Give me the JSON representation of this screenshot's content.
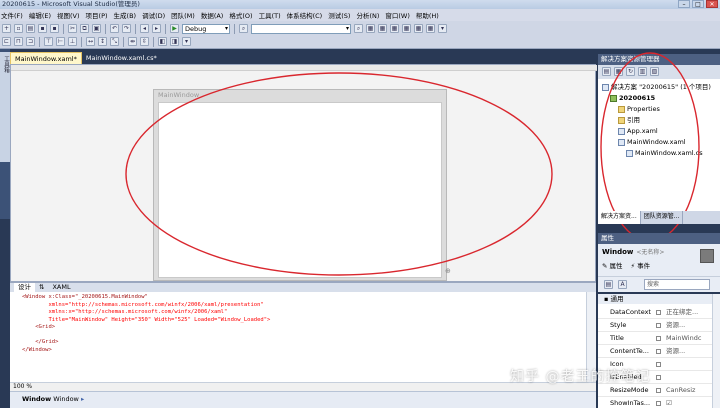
{
  "window": {
    "title": "20200615 - Microsoft Visual Studio(管理员)"
  },
  "menu": [
    "文件(F)",
    "编辑(E)",
    "视图(V)",
    "项目(P)",
    "生成(B)",
    "调试(D)",
    "团队(M)",
    "数据(A)",
    "格式(O)",
    "工具(T)",
    "体系结构(C)",
    "测试(S)",
    "分析(N)",
    "窗口(W)",
    "帮助(H)"
  ],
  "toolbar": {
    "config": "Debug"
  },
  "toolbox": {
    "label": "工具箱"
  },
  "tabs": [
    {
      "label": "MainWindow.xaml*",
      "active": true
    },
    {
      "label": "MainWindow.xaml.cs*",
      "active": false
    }
  ],
  "designer": {
    "window_title": "MainWindow"
  },
  "view_tabs": [
    "设计",
    "XAML"
  ],
  "xaml_lines": [
    "<Window x:Class=\"_20200615.MainWindow\"",
    "        xmlns=\"http://schemas.microsoft.com/winfx/2006/xaml/presentation\"",
    "        xmlns:x=\"http://schemas.microsoft.com/winfx/2006/xaml\"",
    "        Title=\"MainWindow\" Height=\"350\" Width=\"525\" Loaded=\"Window_Loaded\">",
    "    <Grid>",
    "",
    "    </Grid>",
    "</Window>"
  ],
  "zoom": "100 %",
  "breadcrumb": {
    "bold": "Window",
    "rest": "Window"
  },
  "solution_explorer": {
    "title": "解决方案资源管理器",
    "items": [
      {
        "label": "解决方案 \"20200615\" (1 个项目)",
        "indent": 0,
        "icon": "solution"
      },
      {
        "label": "20200615",
        "indent": 1,
        "icon": "project"
      },
      {
        "label": "Properties",
        "indent": 2,
        "icon": "folder"
      },
      {
        "label": "引用",
        "indent": 2,
        "icon": "folder"
      },
      {
        "label": "App.xaml",
        "indent": 2,
        "icon": "file"
      },
      {
        "label": "MainWindow.xaml",
        "indent": 2,
        "icon": "file"
      },
      {
        "label": "MainWindow.xaml.cs",
        "indent": 3,
        "icon": "file"
      }
    ],
    "tabs": [
      "解决方案资...",
      "团队资源管..."
    ]
  },
  "properties": {
    "title": "属性",
    "type": "Window",
    "type_sub": "<无名称>",
    "tab_props": "属性",
    "tab_events": "事件",
    "search_placeholder": "搜索",
    "category": "通用",
    "rows": [
      {
        "name": "DataContext",
        "value": "正在绑定..."
      },
      {
        "name": "Style",
        "value": "资源..."
      },
      {
        "name": "Title",
        "value": "MainWindc"
      },
      {
        "name": "ContentTe...",
        "value": "资源..."
      },
      {
        "name": "Icon",
        "value": ""
      },
      {
        "name": "IsEnabled",
        "value": ""
      },
      {
        "name": "ResizeMode",
        "value": "CanResiz"
      },
      {
        "name": "ShowInTas...",
        "value": "☑"
      }
    ]
  },
  "watermark": "知乎 @老王的控笔记"
}
